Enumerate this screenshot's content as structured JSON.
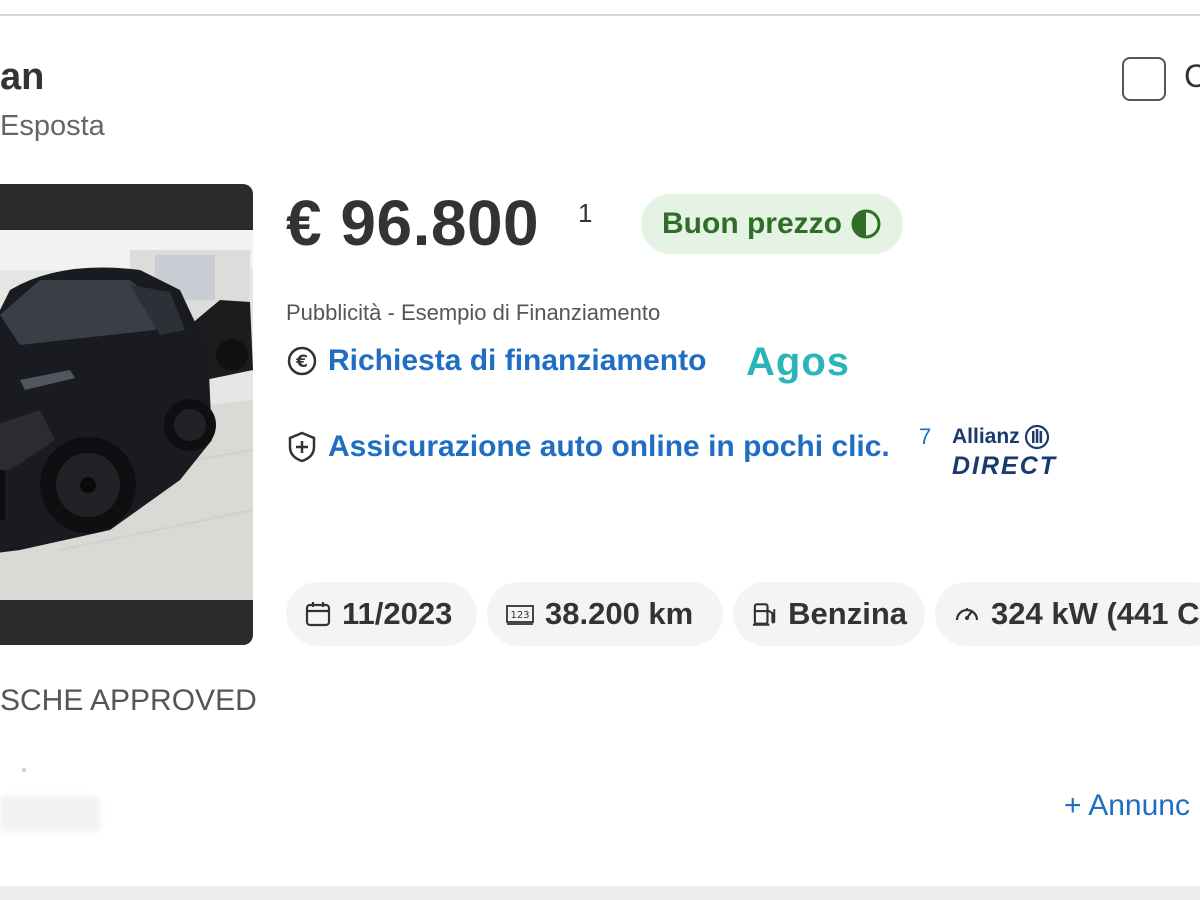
{
  "listing": {
    "title": "an",
    "subtitle": "Esposta",
    "compare_label": "C",
    "price": "€ 96.800",
    "price_note": "1",
    "price_rating": "Buon prezzo",
    "dealer_label": "SCHE APPROVED",
    "more_link": "+ Annunc"
  },
  "finance": {
    "ad_label": "Pubblicità - Esempio di Finanziamento",
    "financing_link": "Richiesta di finanziamento",
    "financing_partner": "Agos",
    "insurance_link": "Assicurazione auto online in pochi clic.",
    "insurance_note": "7",
    "insurance_partner_top": "Allianz",
    "insurance_partner_bottom": "DIRECT"
  },
  "specs": [
    {
      "icon": "calendar-icon",
      "value": "11/2023"
    },
    {
      "icon": "odometer-icon",
      "value": "38.200 km"
    },
    {
      "icon": "fuel-pump-icon",
      "value": "Benzina"
    },
    {
      "icon": "speedometer-icon",
      "value": "324 kW (441 C"
    }
  ],
  "colors": {
    "link": "#1f6ec4",
    "badge_bg": "#e5f3e4",
    "badge_text": "#2e6e27",
    "agos": "#2bb5bb",
    "allianz": "#1a3a6d"
  }
}
